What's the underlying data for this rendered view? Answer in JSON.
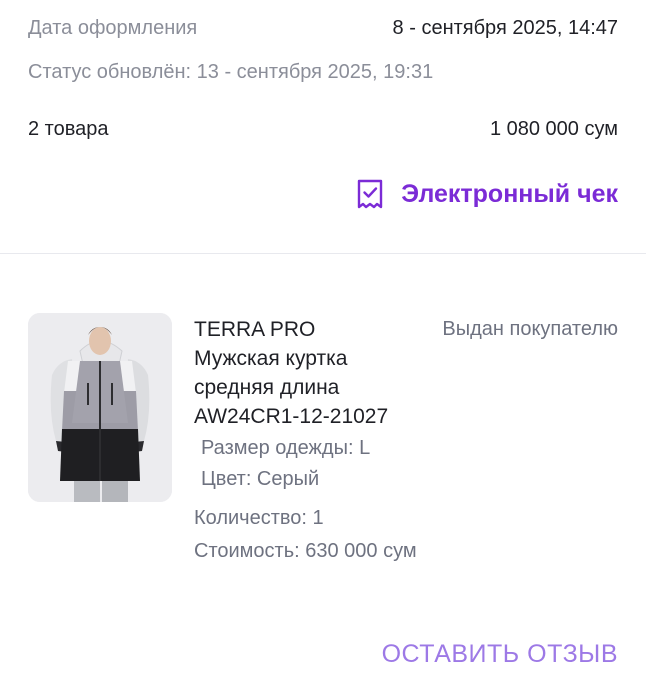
{
  "order": {
    "date_label": "Дата оформления",
    "date_value": "8 - сентября 2025, 14:47",
    "status_updated": "Статус обновлён: 13 - сентября 2025, 19:31",
    "items_count": "2 товара",
    "total": "1 080 000 сум",
    "receipt_label": "Электронный чек"
  },
  "item": {
    "brand": "TERRA PRO",
    "name_line1": "Мужская куртка",
    "name_line2": "средняя длина",
    "sku": "AW24CR1-12-21027",
    "status": "Выдан покупателю",
    "size": "Размер одежды: L",
    "color": "Цвет: Серый",
    "quantity": "Количество: 1",
    "price": "Стоимость: 630 000 сум"
  },
  "actions": {
    "review_label": "ОСТАВИТЬ ОТЗЫВ"
  },
  "colors": {
    "accent": "#7b2bd6",
    "accent_light": "#9d79e6",
    "muted_text": "#8b8e99"
  },
  "icons": {
    "receipt": "receipt-check-icon"
  }
}
